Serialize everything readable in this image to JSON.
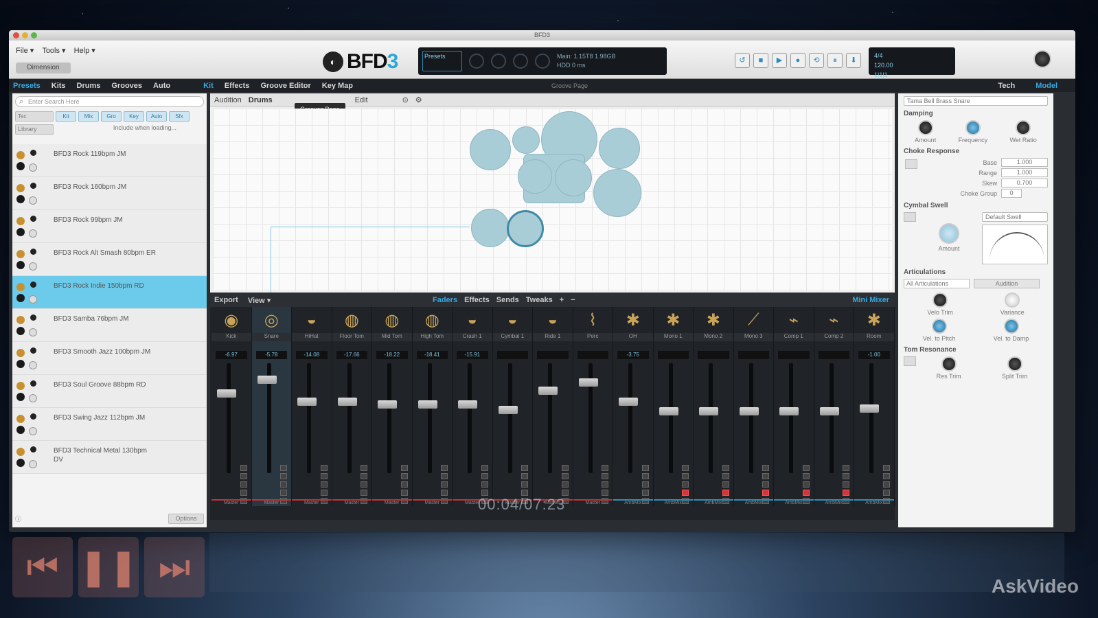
{
  "window": {
    "title": "BFD3"
  },
  "menu": [
    "File ▾",
    "Tools ▾",
    "Help ▾"
  ],
  "dimension_label": "Dimension",
  "logo": {
    "main": "BFD",
    "num": "3"
  },
  "lcd": {
    "preset_label": "Presets",
    "info_line1": "Main: 1.15T8 1.98GB",
    "info_line2": "HDD  0 ms"
  },
  "transport": [
    "↺",
    "■",
    "▶",
    "●",
    "⟲",
    "⏸",
    "⬇"
  ],
  "tempo": {
    "line1": "4/4",
    "line2": "120.00",
    "line3": "1|1|1"
  },
  "tabs": [
    "Presets",
    "Kits",
    "Drums",
    "Grooves",
    "Auto",
    "Kit",
    "Effects",
    "Groove Editor",
    "Key Map"
  ],
  "tabs_center_label": "Groove Page",
  "tabs_right": [
    "Tech",
    "Model"
  ],
  "left": {
    "search_placeholder": "Enter Search Here",
    "filter_select": "Tec",
    "filter_chips": [
      "Kit",
      "Mix",
      "Gro",
      "Key",
      "Auto",
      "Sfx"
    ],
    "library_select": "Library",
    "include_text": "Include when loading...",
    "presets": [
      {
        "name": "BFD3 Rock 119bpm JM",
        "selected": false
      },
      {
        "name": "BFD3 Rock 160bpm JM",
        "selected": false
      },
      {
        "name": "BFD3 Rock 99bpm JM",
        "selected": false
      },
      {
        "name": "BFD3 Rock Alt Smash 80bpm ER",
        "selected": false
      },
      {
        "name": "BFD3 Rock Indie 150bpm RD",
        "selected": true
      },
      {
        "name": "BFD3 Samba 76bpm JM",
        "selected": false
      },
      {
        "name": "BFD3 Smooth Jazz 100bpm JM",
        "selected": false
      },
      {
        "name": "BFD3 Soul Groove 88bpm RD",
        "selected": false
      },
      {
        "name": "BFD3 Swing Jazz 112bpm JM",
        "selected": false
      },
      {
        "name": "BFD3 Technical Metal 130bpm DV",
        "selected": false
      }
    ],
    "options_label": "Options"
  },
  "center": {
    "head_left": "Audition",
    "head_drums": "Drums",
    "head_extra": "Edit",
    "tooltip": "Grooves Page"
  },
  "mixer": {
    "left_tabs": [
      "Export",
      "View ▾"
    ],
    "mid_tabs": [
      "Faders",
      "Effects",
      "Sends",
      "Tweaks"
    ],
    "mini_label": "Mini Mixer",
    "timecode": "00:04/07:23",
    "channels": [
      {
        "label": "Kick",
        "value": "-6.97",
        "icon": "◉",
        "red": false,
        "out": "Master"
      },
      {
        "label": "Snare",
        "value": "-5.78",
        "icon": "◎",
        "red": false,
        "out": "Master"
      },
      {
        "label": "HiHat",
        "value": "-14.08",
        "icon": "◒",
        "red": false,
        "out": "Master"
      },
      {
        "label": "Floor Tom",
        "value": "-17.66",
        "icon": "◍",
        "red": false,
        "out": "Master"
      },
      {
        "label": "Mid Tom",
        "value": "-18.22",
        "icon": "◍",
        "red": false,
        "out": "Master"
      },
      {
        "label": "High Tom",
        "value": "-18.41",
        "icon": "◍",
        "red": false,
        "out": "Master"
      },
      {
        "label": "Crash 1",
        "value": "-15.91",
        "icon": "◒",
        "red": false,
        "out": "Master"
      },
      {
        "label": "Cymbal 1",
        "value": "",
        "icon": "◒",
        "red": false,
        "out": "Master"
      },
      {
        "label": "Ride 1",
        "value": "",
        "icon": "◒",
        "red": false,
        "out": "Master"
      },
      {
        "label": "Perc",
        "value": "",
        "icon": "⌇",
        "red": false,
        "out": "Master"
      },
      {
        "label": "OH",
        "value": "-3.75",
        "icon": "✱",
        "red": false,
        "out": "AmbMix"
      },
      {
        "label": "Mono 1",
        "value": "",
        "icon": "✱",
        "red": true,
        "out": "AmbMix"
      },
      {
        "label": "Mono 2",
        "value": "",
        "icon": "✱",
        "red": true,
        "out": "AmbMix"
      },
      {
        "label": "Mono 3",
        "value": "",
        "icon": "⟋",
        "red": true,
        "out": "AmbMix"
      },
      {
        "label": "Comp 1",
        "value": "",
        "icon": "⌁",
        "red": true,
        "out": "AmbMix"
      },
      {
        "label": "Comp 2",
        "value": "",
        "icon": "⌁",
        "red": true,
        "out": "AmbMix"
      },
      {
        "label": "Room",
        "value": "-1.00",
        "icon": "✱",
        "red": false,
        "out": "AmbMix"
      }
    ]
  },
  "right": {
    "drum_select": "Tama Bell Brass Snare",
    "damping_title": "Damping",
    "damping_knobs": [
      "Amount",
      "Frequency",
      "Wet Ratio"
    ],
    "choke_title": "Choke Response",
    "choke_fields": [
      {
        "label": "Base",
        "value": "1.000"
      },
      {
        "label": "Range",
        "value": "1.000"
      },
      {
        "label": "Skew",
        "value": "0.700"
      },
      {
        "label": "Choke Group",
        "value": "0"
      }
    ],
    "swell_title": "Cymbal Swell",
    "swell_knob": "Amount",
    "swell_select": "Default Swell",
    "artic_title": "Articulations",
    "artic_select": "All Articulations",
    "artic_button": "Audition",
    "artic_knobs": [
      "Velo Trim",
      "Variance",
      "Vel. to Pitch",
      "Vel. to Damp"
    ],
    "tom_title": "Tom Resonance",
    "tom_knobs": [
      "Res Trim",
      "Split Trim"
    ]
  },
  "video": {
    "prev": "⏮",
    "pause": "❚❚",
    "next": "⏭"
  },
  "watermark": "AskVideo"
}
